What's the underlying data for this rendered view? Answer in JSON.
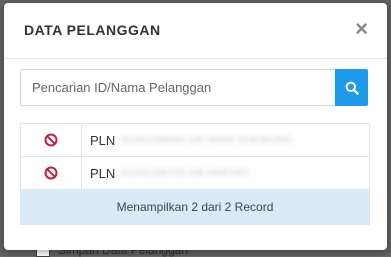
{
  "background": {
    "checkbox_label": "Simpan Data Pelanggan"
  },
  "modal": {
    "title": "DATA PELANGGAN",
    "close_label": "×",
    "search": {
      "placeholder": "Pencarian ID/Nama Pelanggan",
      "value": "",
      "button_icon": "search-icon"
    },
    "rows": [
      {
        "action_icon": "ban-icon",
        "prefix": "PLN",
        "detail": "51241299000 DR IMAM SOEWONO"
      },
      {
        "action_icon": "ban-icon",
        "prefix": "PLN",
        "detail": "51241298725 DB HARTATI"
      }
    ],
    "footer": "Menampilkan 2 dari 2 Record"
  },
  "colors": {
    "accent": "#1e9be8",
    "ban": "#c0233d",
    "footer_bg": "#dbeaf7"
  }
}
